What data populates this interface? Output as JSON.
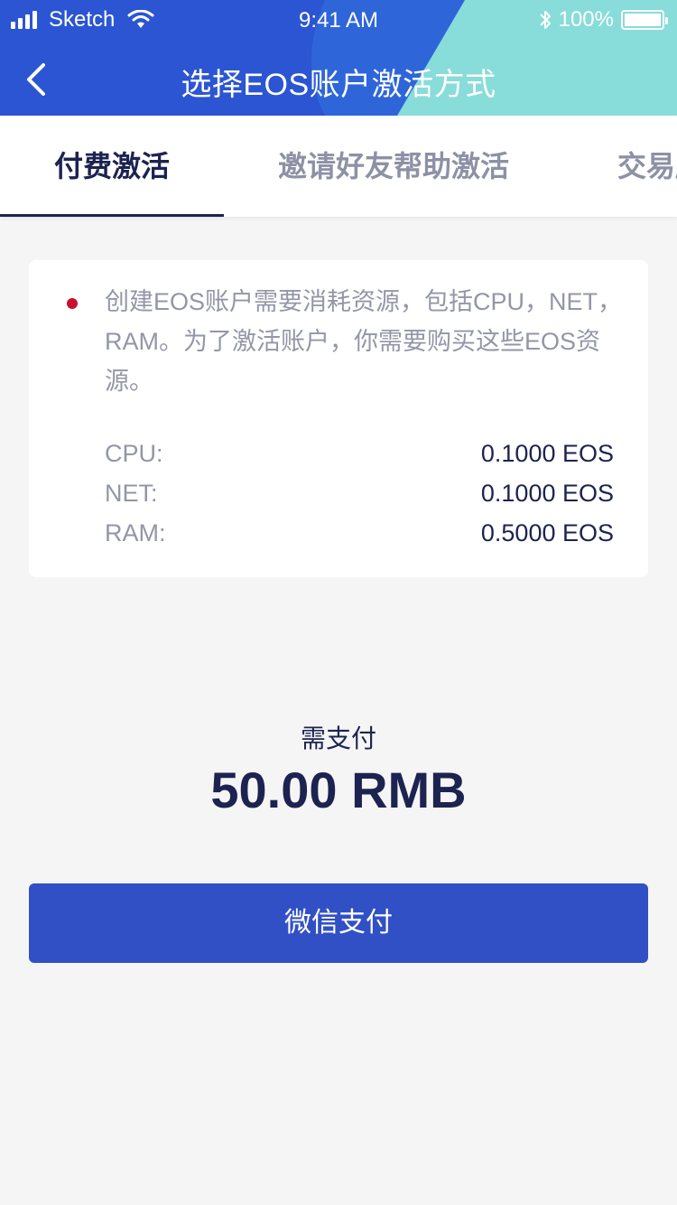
{
  "status_bar": {
    "carrier": "Sketch",
    "time": "9:41 AM",
    "battery": "100%",
    "icons": [
      "signal-icon",
      "wifi-icon",
      "bluetooth-icon",
      "battery-icon"
    ]
  },
  "nav": {
    "title": "选择EOS账户激活方式",
    "back_icon": "chevron-left-icon"
  },
  "tabs": [
    {
      "label": "付费激活",
      "active": true
    },
    {
      "label": "邀请好友帮助激活",
      "active": false
    },
    {
      "label": "交易所",
      "active": false
    }
  ],
  "card": {
    "description": "创建EOS账户需要消耗资源，包括CPU，NET，RAM。为了激活账户，你需要购买这些EOS资源。",
    "resources": [
      {
        "label": "CPU:",
        "value": "0.1000 EOS"
      },
      {
        "label": "NET:",
        "value": "0.1000 EOS"
      },
      {
        "label": "RAM:",
        "value": "0.5000 EOS"
      }
    ]
  },
  "payment": {
    "label": "需支付",
    "amount": "50.00 RMB",
    "button_label": "微信支付"
  },
  "colors": {
    "header_blue": "#2b55d2",
    "header_teal": "#88dcd9",
    "dark_text": "#1d2350",
    "muted_text": "#9396a7",
    "bullet_red": "#c8102e",
    "button_blue": "#3150c6",
    "background": "#f5f5f5"
  }
}
